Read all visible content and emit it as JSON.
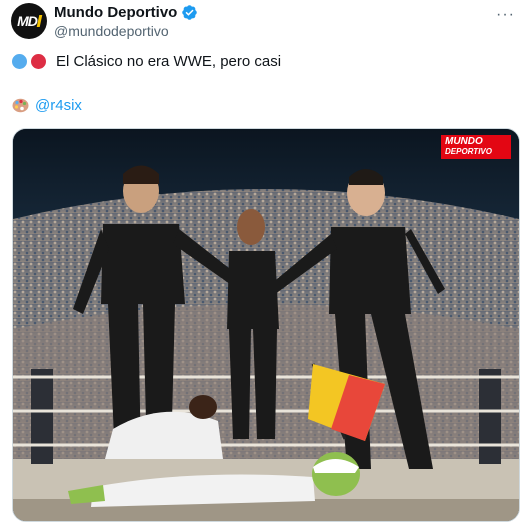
{
  "tweet": {
    "author": {
      "display_name": "Mundo Deportivo",
      "handle": "@mundodeportivo",
      "verified": true,
      "avatar_text": "MD"
    },
    "text": "El Clásico no era WWE, pero casi",
    "emoji_prefix": [
      "blue-circle-icon",
      "red-circle-icon"
    ],
    "credit_emoji": "artist-palette-icon",
    "credit_mention": "@r4six",
    "more_icon": "more-options-icon"
  },
  "media": {
    "logo_line1": "MUNDO",
    "logo_line2": "DEPORTIVO",
    "colors": {
      "logo_red": "#e30613",
      "flag_yellow": "#f3c623",
      "flag_red": "#e8473a",
      "uniform_black": "#1a1a1a"
    }
  },
  "colors": {
    "accent": "#1d9bf0",
    "text": "#0f1419",
    "secondary_text": "#536471"
  }
}
